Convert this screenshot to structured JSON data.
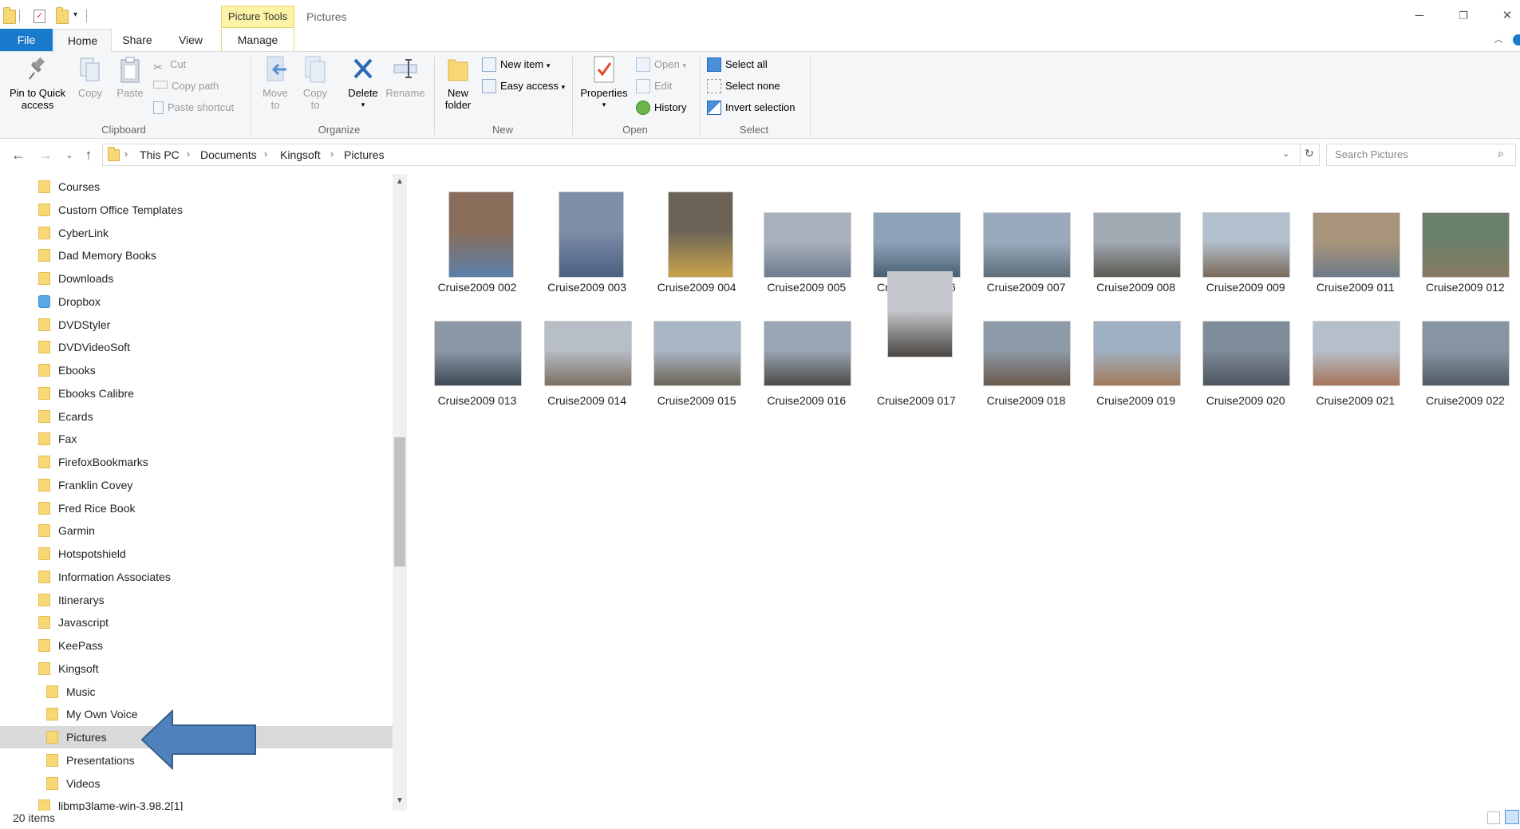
{
  "window": {
    "title": "Pictures",
    "contextual_tab": "Picture Tools"
  },
  "tabs": {
    "file": "File",
    "home": "Home",
    "share": "Share",
    "view": "View",
    "manage": "Manage"
  },
  "ribbon": {
    "clipboard": {
      "pin": "Pin to Quick access",
      "copy": "Copy",
      "paste": "Paste",
      "cut": "Cut",
      "copy_path": "Copy path",
      "paste_shortcut": "Paste shortcut",
      "label": "Clipboard"
    },
    "organize": {
      "move_to": "Move to",
      "copy_to": "Copy to",
      "delete": "Delete",
      "rename": "Rename",
      "label": "Organize"
    },
    "new": {
      "new_folder": "New folder",
      "new_item": "New item",
      "easy_access": "Easy access",
      "label": "New"
    },
    "open": {
      "properties": "Properties",
      "open": "Open",
      "edit": "Edit",
      "history": "History",
      "label": "Open"
    },
    "select": {
      "select_all": "Select all",
      "select_none": "Select none",
      "invert": "Invert selection",
      "label": "Select"
    }
  },
  "address": {
    "crumbs": [
      "This PC",
      "Documents",
      "Kingsoft",
      "Pictures"
    ],
    "search_placeholder": "Search Pictures"
  },
  "nav": {
    "items": [
      "Courses",
      "Custom Office Templates",
      "CyberLink",
      "Dad Memory Books",
      "Downloads",
      "Dropbox",
      "DVDStyler",
      "DVDVideoSoft",
      "Ebooks",
      "Ebooks Calibre",
      "Ecards",
      "Fax",
      "FirefoxBookmarks",
      "Franklin Covey",
      "Fred Rice Book",
      "Garmin",
      "Hotspotshield",
      "Information Associates",
      "Itinerarys",
      "Javascript",
      "KeePass",
      "Kingsoft",
      "Music",
      "My Own Voice",
      "Pictures",
      "Presentations",
      "Videos",
      "libmp3lame-win-3.98.2[1]"
    ],
    "selected": "Pictures"
  },
  "files": [
    "Cruise2009 002",
    "Cruise2009 003",
    "Cruise2009 004",
    "Cruise2009 005",
    "Cruise2009 006",
    "Cruise2009 007",
    "Cruise2009 008",
    "Cruise2009 009",
    "Cruise2009 011",
    "Cruise2009 012",
    "Cruise2009 013",
    "Cruise2009 014",
    "Cruise2009 015",
    "Cruise2009 016",
    "Cruise2009 017",
    "Cruise2009 018",
    "Cruise2009 019",
    "Cruise2009 020",
    "Cruise2009 021",
    "Cruise2009 022"
  ],
  "status": {
    "item_count": "20 items"
  },
  "colors": {
    "accent": "#1979ca",
    "contextual": "#fbf3a6",
    "arrow": "#4f81bd",
    "selection": "#d9d9d9"
  }
}
